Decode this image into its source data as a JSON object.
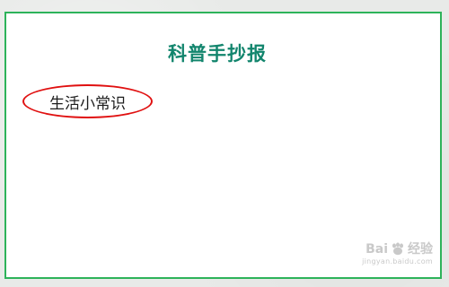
{
  "document": {
    "title": "科普手抄报",
    "section_label": "生活小常识"
  },
  "watermark": {
    "brand_left": "Bai",
    "brand_right": "经验",
    "url": "jingyan.baidu.com",
    "paw_icon": "baidu-paw-icon"
  },
  "colors": {
    "border": "#2db35a",
    "title": "#12856d",
    "oval": "#e01010"
  }
}
